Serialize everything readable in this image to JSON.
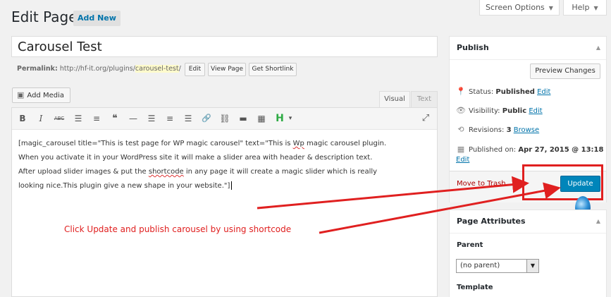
{
  "top_tabs": {
    "screen_options": "Screen Options",
    "help": "Help"
  },
  "heading": {
    "title": "Edit Page",
    "add_new": "Add New"
  },
  "post": {
    "title": "Carousel Test",
    "permalink_label": "Permalink:",
    "permalink_base": "http://hf-it.org/plugins/",
    "permalink_slug": "carousel-test",
    "permalink_tail": "/",
    "edit_btn": "Edit",
    "view_page_btn": "View Page",
    "shortlink_btn": "Get Shortlink"
  },
  "editor": {
    "add_media": "Add Media",
    "tab_visual": "Visual",
    "tab_text": "Text",
    "toolbar": [
      {
        "name": "bold",
        "glyph": "B"
      },
      {
        "name": "italic",
        "glyph": "I"
      },
      {
        "name": "strikethrough",
        "glyph": "ABC"
      },
      {
        "name": "bulleted-list",
        "glyph": "☰"
      },
      {
        "name": "numbered-list",
        "glyph": "≡"
      },
      {
        "name": "blockquote",
        "glyph": "❝"
      },
      {
        "name": "horizontal-line",
        "glyph": "—"
      },
      {
        "name": "align-left",
        "glyph": "☰"
      },
      {
        "name": "align-center",
        "glyph": "≡"
      },
      {
        "name": "align-right",
        "glyph": "☰"
      },
      {
        "name": "insert-link",
        "glyph": "🔗"
      },
      {
        "name": "remove-link",
        "glyph": "⛓"
      },
      {
        "name": "read-more",
        "glyph": "▬"
      },
      {
        "name": "toolbar-toggle",
        "glyph": "▦"
      },
      {
        "name": "heading",
        "glyph": "H"
      },
      {
        "name": "heading-dropdown",
        "glyph": "▾"
      },
      {
        "name": "fullscreen",
        "glyph": "⤢"
      }
    ],
    "lines": {
      "l1_pre": "[magic_carousel title=\"This is test page for WP magic carousel\" text=\"This is ",
      "l1_wp": "Wp",
      "l1_post": " magic carousel plugin.",
      "l2": "When you activate it in your WordPress site it will make a slider area with header & description text.",
      "l3_pre": "After upload slider images & put the ",
      "l3_sc": "shortcode",
      "l3_post": " in any page it will create a magic slider which is really",
      "l4": "looking nice.This plugin give a new shape in your website.\"]"
    }
  },
  "callout": "Click Update and publish carousel by using shortcode",
  "publish": {
    "title": "Publish",
    "preview": "Preview Changes",
    "status_label": "Status:",
    "status_value": "Published",
    "status_edit": "Edit",
    "visibility_label": "Visibility:",
    "visibility_value": "Public",
    "visibility_edit": "Edit",
    "revisions_label": "Revisions:",
    "revisions_value": "3",
    "revisions_link": "Browse",
    "published_label": "Published on:",
    "published_value": "Apr 27, 2015 @ 13:18",
    "published_edit": "Edit",
    "trash": "Move to Trash",
    "update": "Update"
  },
  "page_attributes": {
    "title": "Page Attributes",
    "parent_label": "Parent",
    "parent_value": "(no parent)",
    "template_label": "Template"
  },
  "colors": {
    "accent": "#0085ba",
    "link": "#0073aa",
    "annotation": "#e02020"
  }
}
